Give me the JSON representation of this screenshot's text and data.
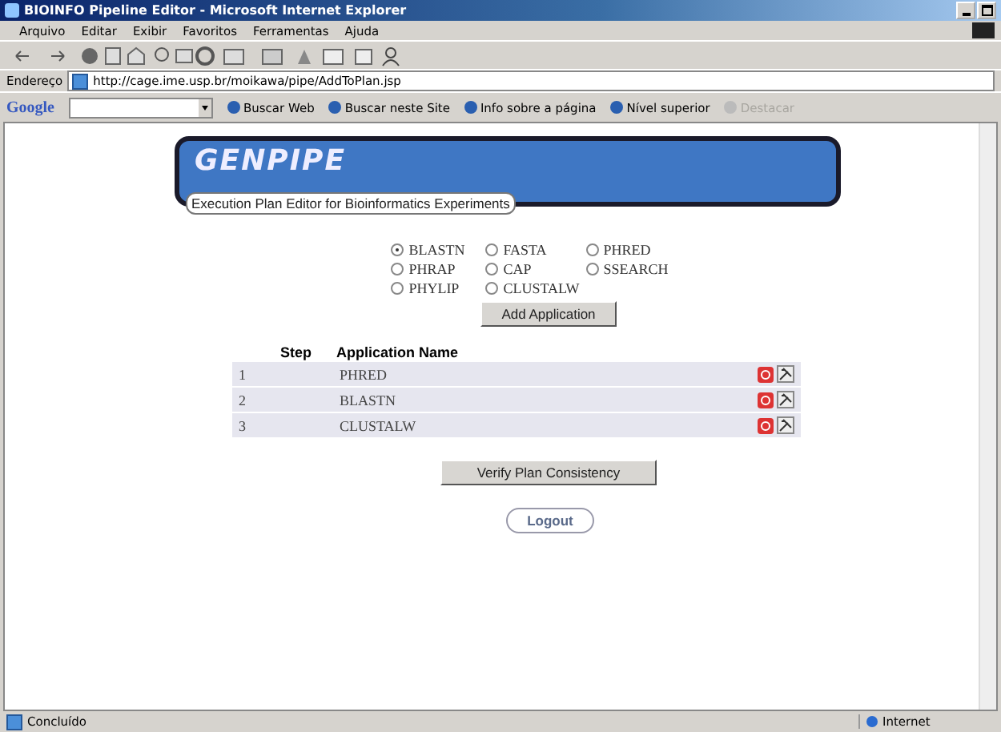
{
  "window": {
    "title": "BIOINFO Pipeline Editor - Microsoft Internet Explorer"
  },
  "menu": [
    "Arquivo",
    "Editar",
    "Exibir",
    "Favoritos",
    "Ferramentas",
    "Ajuda"
  ],
  "address": {
    "label": "Endereço",
    "url": "http://cage.ime.usp.br/moikawa/pipe/AddToPlan.jsp"
  },
  "google_bar": {
    "logo": "Google",
    "buttons": [
      {
        "label": "Buscar Web",
        "disabled": false
      },
      {
        "label": "Buscar neste Site",
        "disabled": false
      },
      {
        "label": "Info sobre a página",
        "disabled": false
      },
      {
        "label": "Nível superior",
        "disabled": false
      },
      {
        "label": "Destacar",
        "disabled": true
      }
    ]
  },
  "page": {
    "logo": "GENPIPE",
    "subtitle": "Execution Plan Editor for Bioinformatics Experiments",
    "options": [
      {
        "label": "BLASTN",
        "selected": true
      },
      {
        "label": "FASTA",
        "selected": false
      },
      {
        "label": "PHRED",
        "selected": false
      },
      {
        "label": "PHRAP",
        "selected": false
      },
      {
        "label": "CAP",
        "selected": false
      },
      {
        "label": "SSEARCH",
        "selected": false
      },
      {
        "label": "PHYLIP",
        "selected": false
      },
      {
        "label": "CLUSTALW",
        "selected": false
      }
    ],
    "add_button": "Add Application",
    "columns": [
      "Step",
      "Application Name"
    ],
    "rows": [
      {
        "step": "1",
        "name": "PHRED"
      },
      {
        "step": "2",
        "name": "BLASTN"
      },
      {
        "step": "3",
        "name": "CLUSTALW"
      }
    ],
    "verify_button": "Verify Plan Consistency",
    "logout_button": "Logout"
  },
  "status_bar": {
    "text": "Concluído",
    "zone": "Internet"
  }
}
